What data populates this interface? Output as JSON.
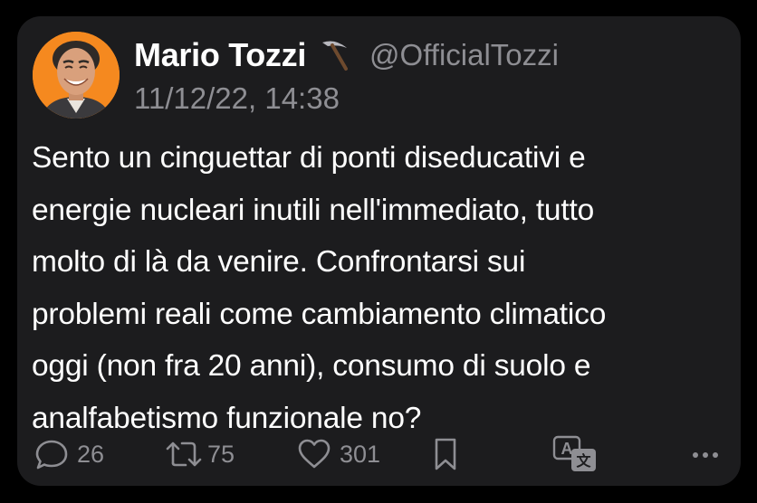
{
  "tweet": {
    "author": {
      "display_name": "Mario Tozzi",
      "emoji_icon": "pick-icon",
      "handle": "@OfficialTozzi",
      "avatar_bg": "#f5891f"
    },
    "timestamp": "11/12/22, 14:38",
    "text_lines": [
      "Sento un cinguettar di ponti diseducativi e",
      "energie nucleari inutili nell'immediato, tutto",
      "molto di là da venire. Confrontarsi sui",
      "problemi reali come cambiamento climatico",
      "oggi (non fra 20 anni), consumo di suolo e",
      "analfabetismo funzionale no?"
    ]
  },
  "actions": {
    "replies": {
      "icon": "reply-icon",
      "count": "26"
    },
    "retweets": {
      "icon": "retweet-icon",
      "count": "75"
    },
    "likes": {
      "icon": "heart-icon",
      "count": "301"
    },
    "bookmark": {
      "icon": "bookmark-icon"
    },
    "translate": {
      "icon": "translate-icon"
    },
    "more": {
      "icon": "more-icon"
    }
  },
  "colors": {
    "background": "#000000",
    "card": "#1c1c1e",
    "text": "#ffffff",
    "secondary": "#8e8e93"
  }
}
